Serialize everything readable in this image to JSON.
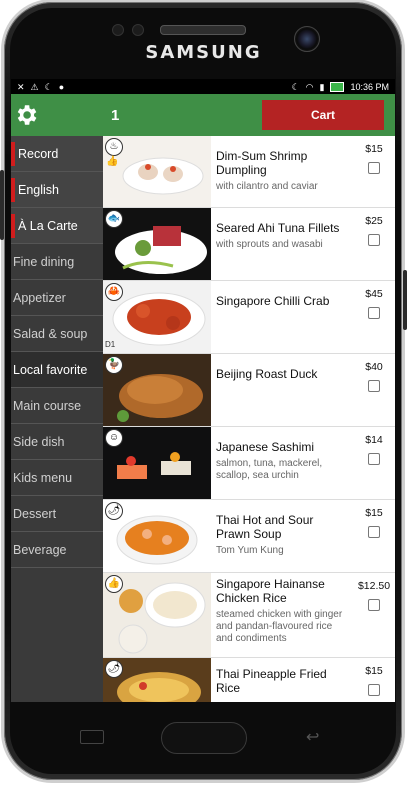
{
  "device": {
    "brand": "SAMSUNG"
  },
  "status_bar": {
    "time": "10:36 PM"
  },
  "topbar": {
    "table_number": "1",
    "cart_label": "Cart"
  },
  "sidebar": {
    "items": [
      {
        "label": "Record"
      },
      {
        "label": "English"
      },
      {
        "label": "À La Carte"
      },
      {
        "label": "Fine dining"
      },
      {
        "label": "Appetizer"
      },
      {
        "label": "Salad & soup"
      },
      {
        "label": "Local favorite"
      },
      {
        "label": "Main course"
      },
      {
        "label": "Side dish"
      },
      {
        "label": "Kids menu"
      },
      {
        "label": "Dessert"
      },
      {
        "label": "Beverage"
      }
    ]
  },
  "menu": {
    "items": [
      {
        "name": "Dim-Sum Shrimp Dumpling",
        "desc": "with cilantro and caviar",
        "price": "$15",
        "code": ""
      },
      {
        "name": "Seared Ahi Tuna Fillets",
        "desc": "with sprouts and wasabi",
        "price": "$25",
        "code": ""
      },
      {
        "name": "Singapore Chilli Crab",
        "desc": "",
        "price": "$45",
        "code": "D1"
      },
      {
        "name": "Beijing Roast Duck",
        "desc": "",
        "price": "$40",
        "code": ""
      },
      {
        "name": "Japanese Sashimi",
        "desc": "salmon, tuna, mackerel, scallop, sea urchin",
        "price": "$14",
        "code": ""
      },
      {
        "name": "Thai Hot and Sour Prawn Soup",
        "desc": "Tom Yum Kung",
        "price": "$15",
        "code": ""
      },
      {
        "name": "Singapore Hainanse Chicken Rice",
        "desc": "steamed chicken with ginger and pandan-flavoured rice and condiments",
        "price": "$12.50",
        "code": ""
      },
      {
        "name": "Thai Pineapple Fried Rice",
        "desc": "",
        "price": "$15",
        "code": ""
      }
    ]
  },
  "colors": {
    "topbar": "#3f8f46",
    "cart": "#b42323",
    "sidebar": "#3a3a3a",
    "flag": "#d11d1d"
  }
}
